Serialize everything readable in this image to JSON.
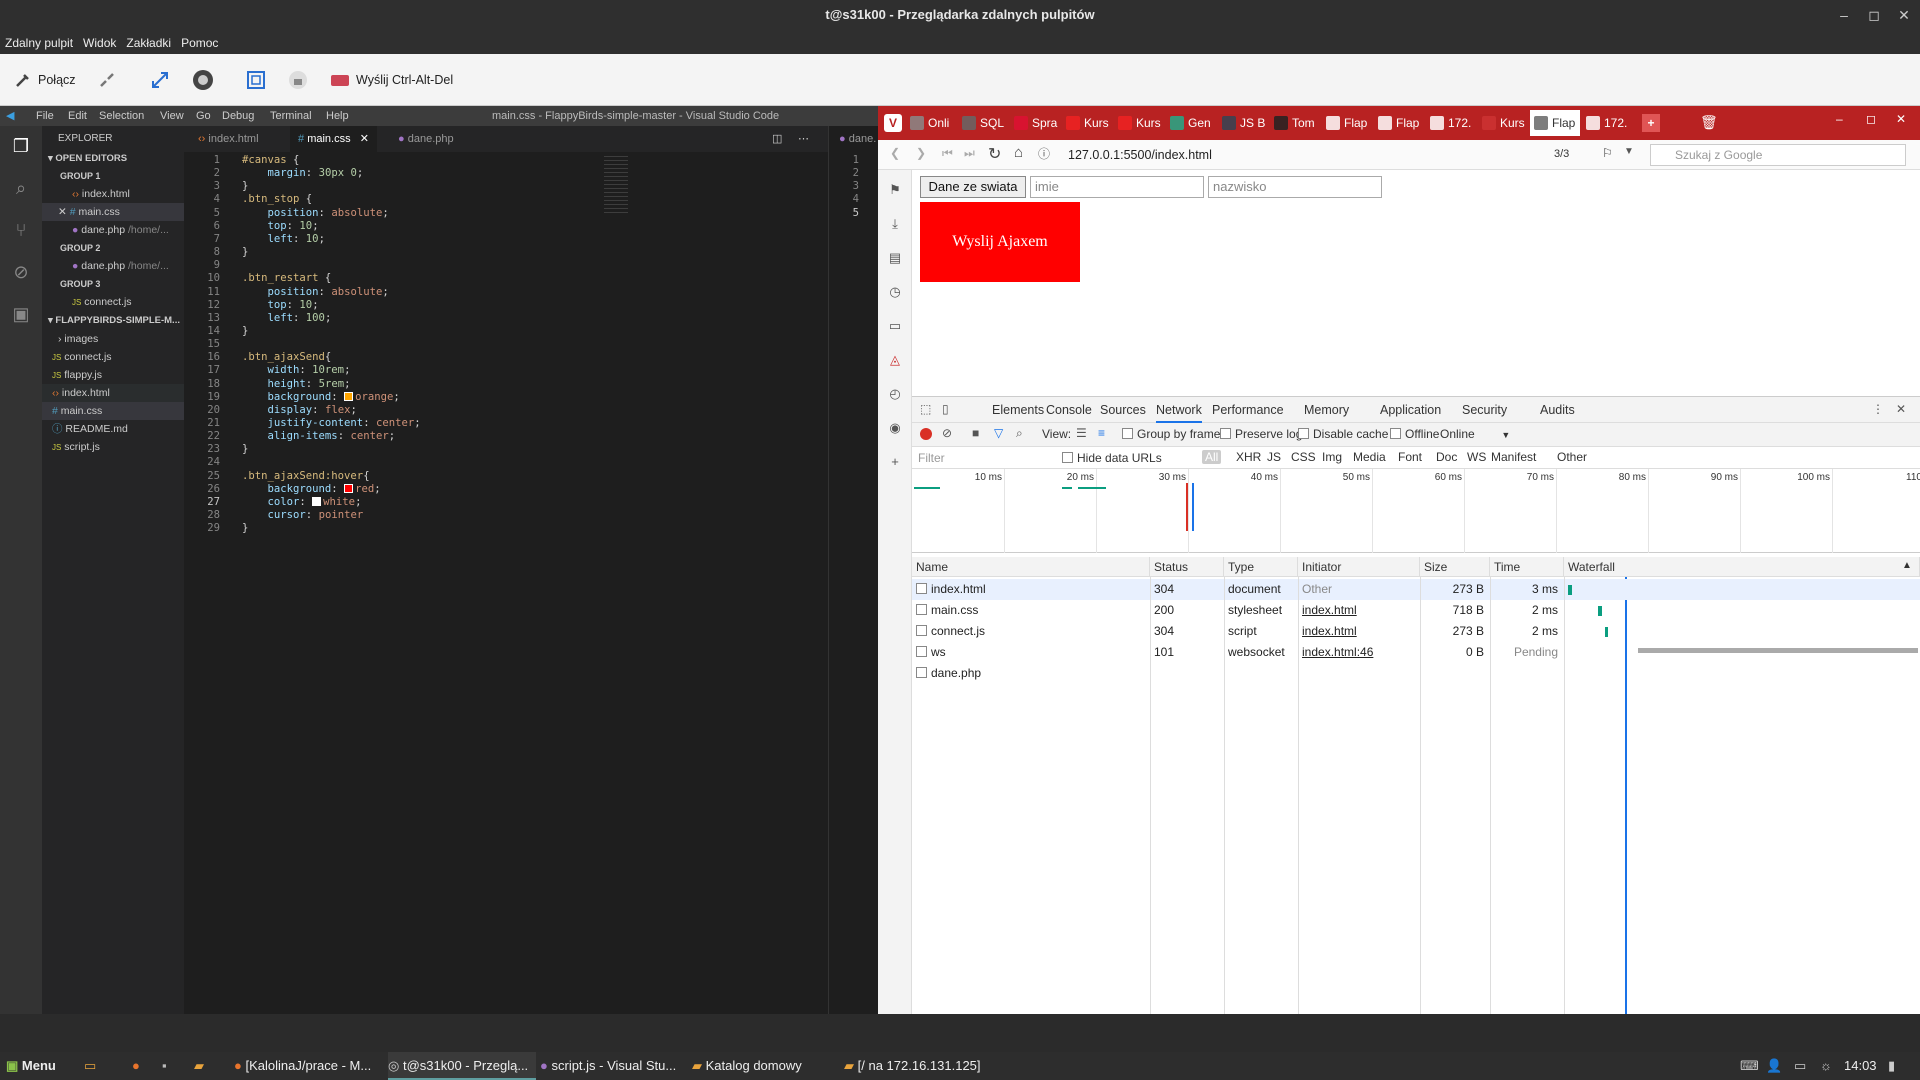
{
  "window": {
    "title": "t@s31k00 - Przeglądarka zdalnych pulpitów"
  },
  "menu": [
    "Zdalny pulpit",
    "Widok",
    "Zakładki",
    "Pomoc"
  ],
  "toolbar": {
    "connect": "Połącz",
    "send_cad": "Wyślij Ctrl-Alt-Del"
  },
  "vscode": {
    "menu": [
      "File",
      "Edit",
      "Selection",
      "View",
      "Go",
      "Debug",
      "Terminal",
      "Help"
    ],
    "title": "main.css - FlappyBirds-simple-master - Visual Studio Code",
    "explorer": {
      "header": "EXPLORER",
      "open_editors": "OPEN EDITORS",
      "group1": "GROUP 1",
      "g1_files": [
        "index.html",
        "main.css",
        "dane.php"
      ],
      "dane_path": "/home/...",
      "group2": "GROUP 2",
      "g2_file": "dane.php",
      "group3": "GROUP 3",
      "g3_file": "connect.js",
      "project": "FLAPPYBIRDS-SIMPLE-M...",
      "files": [
        "images",
        "connect.js",
        "flappy.js",
        "index.html",
        "main.css",
        "README.md",
        "script.js"
      ]
    },
    "tabs": [
      "index.html",
      "main.css",
      "dane.php"
    ],
    "right_tab": "dane.",
    "right_lines": [
      "1",
      "2",
      "3",
      "4",
      "5"
    ],
    "code": [
      "#canvas {",
      "    margin: 30px 0;",
      "}",
      ".btn_stop {",
      "    position: absolute;",
      "    top:10;",
      "    left:10;",
      "}",
      "",
      ".btn_restart {",
      "    position: absolute;",
      "    top:10;",
      "    left:100;",
      "}",
      "",
      ".btn_ajaxSend{",
      "    width: 10rem;",
      "    height: 5rem;",
      "    background: orange;",
      "    display: flex;",
      "    justify-content: center;",
      "    align-items: center;",
      "}",
      "",
      ".btn_ajaxSend:hover{",
      "    background: red;",
      "    color: white;",
      "    cursor: pointer",
      "}"
    ]
  },
  "browser": {
    "tabs": [
      "Onli",
      "SQL",
      "Spra",
      "Kurs",
      "Kurs",
      "Gen",
      "JS B",
      "Tom",
      "Flap",
      "Flap",
      "172.",
      "Kurs",
      "Flap",
      "172."
    ],
    "url": "127.0.0.1:5500/index.html",
    "page_count": "3/3",
    "search_placeholder": "Szukaj z Google",
    "page": {
      "button": "Dane ze swiata",
      "input1_placeholder": "imie",
      "input2_placeholder": "nazwisko",
      "red_button": "Wyslij Ajaxem"
    },
    "devtools": {
      "tabs": [
        "Elements",
        "Console",
        "Sources",
        "Network",
        "Performance",
        "Memory",
        "Application",
        "Security",
        "Audits"
      ],
      "view_label": "View:",
      "group_by_frame": "Group by frame",
      "preserve_log": "Preserve log",
      "disable_cache": "Disable cache",
      "offline": "Offline",
      "throttle": "Online",
      "filter_placeholder": "Filter",
      "hide_data_urls": "Hide data URLs",
      "types": [
        "All",
        "XHR",
        "JS",
        "CSS",
        "Img",
        "Media",
        "Font",
        "Doc",
        "WS",
        "Manifest",
        "Other"
      ],
      "ticks": [
        "10 ms",
        "20 ms",
        "30 ms",
        "40 ms",
        "50 ms",
        "60 ms",
        "70 ms",
        "80 ms",
        "90 ms",
        "100 ms",
        "110"
      ],
      "columns": [
        "Name",
        "Status",
        "Type",
        "Initiator",
        "Size",
        "Time",
        "Waterfall"
      ],
      "rows": [
        {
          "name": "index.html",
          "status": "304",
          "type": "document",
          "initiator": "Other",
          "size": "273 B",
          "time": "3 ms"
        },
        {
          "name": "main.css",
          "status": "200",
          "type": "stylesheet",
          "initiator": "index.html",
          "size": "718 B",
          "time": "2 ms"
        },
        {
          "name": "connect.js",
          "status": "304",
          "type": "script",
          "initiator": "index.html",
          "size": "273 B",
          "time": "2 ms"
        },
        {
          "name": "ws",
          "status": "101",
          "type": "websocket",
          "initiator": "index.html:46",
          "size": "0 B",
          "time": "Pending"
        },
        {
          "name": "dane.php",
          "status": "",
          "type": "",
          "initiator": "",
          "size": "",
          "time": ""
        }
      ]
    }
  },
  "taskbar": {
    "menu": "Menu",
    "items": [
      "[KalolinaJ/prace - M...",
      "t@s31k00 - Przeglą...",
      "script.js - Visual Stu...",
      "Katalog domowy",
      "[/ na 172.16.131.125]"
    ],
    "clock": "14:03"
  },
  "colors": {
    "accent_red": "#ff0000",
    "vivaldi_tab_bar": "#b82222",
    "vscode_bg": "#1e1e1e"
  }
}
